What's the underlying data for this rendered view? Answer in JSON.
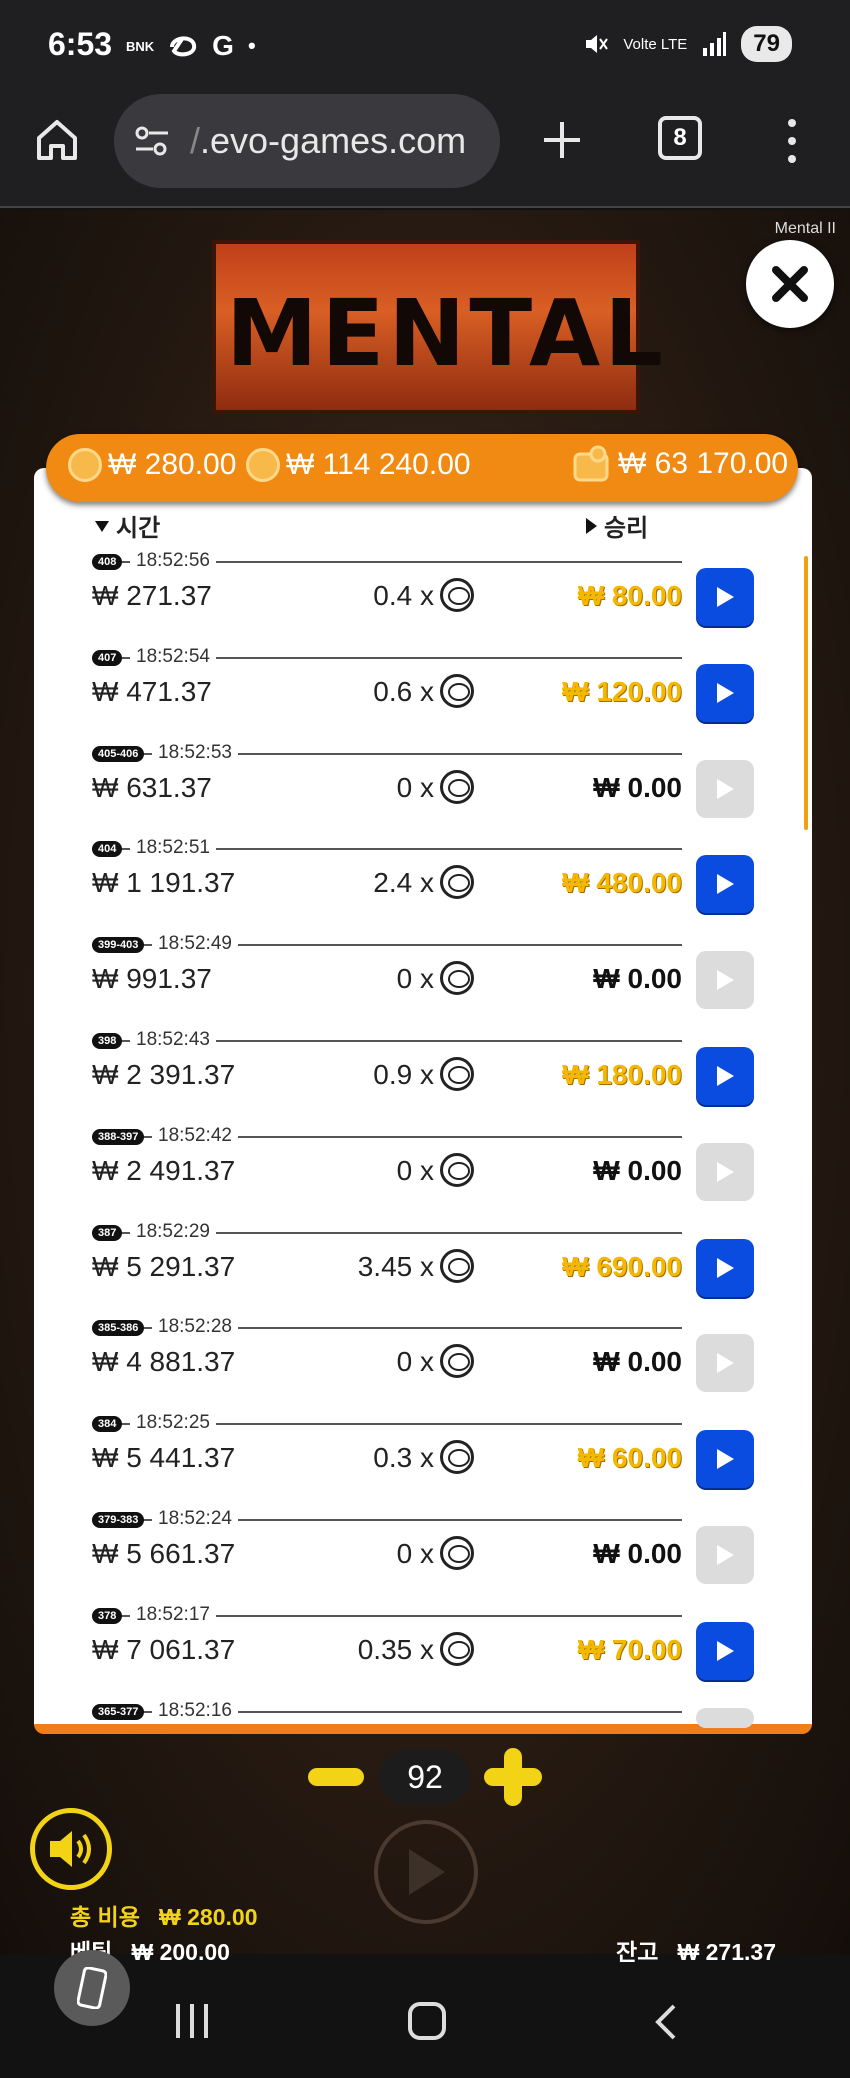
{
  "status_bar": {
    "time": "6:53",
    "left_icons": [
      "BNK",
      "threads-icon",
      "G",
      "•"
    ],
    "network": "Volte LTE",
    "battery": "79"
  },
  "browser": {
    "url_prefix": "/",
    "url": ".evo-games.com",
    "tab_count": "8"
  },
  "game": {
    "title_tag": "Mental II",
    "logo_text": "MENTAL"
  },
  "totals": {
    "cost": "₩ 280.00",
    "total_won": "₩ 114 240.00",
    "wallet": "₩ 63 170.00"
  },
  "columns": {
    "time": "시간",
    "win": "승리"
  },
  "rows": [
    {
      "id": "408",
      "time": "18:52:56",
      "balance": "₩ 271.37",
      "mult": "0.4 x",
      "win": "₩ 80.00",
      "positive": true
    },
    {
      "id": "407",
      "time": "18:52:54",
      "balance": "₩ 471.37",
      "mult": "0.6 x",
      "win": "₩ 120.00",
      "positive": true
    },
    {
      "id": "405-406",
      "time": "18:52:53",
      "balance": "₩ 631.37",
      "mult": "0 x",
      "win": "₩ 0.00",
      "positive": false
    },
    {
      "id": "404",
      "time": "18:52:51",
      "balance": "₩ 1 191.37",
      "mult": "2.4 x",
      "win": "₩ 480.00",
      "positive": true
    },
    {
      "id": "399-403",
      "time": "18:52:49",
      "balance": "₩ 991.37",
      "mult": "0 x",
      "win": "₩ 0.00",
      "positive": false
    },
    {
      "id": "398",
      "time": "18:52:43",
      "balance": "₩ 2 391.37",
      "mult": "0.9 x",
      "win": "₩ 180.00",
      "positive": true
    },
    {
      "id": "388-397",
      "time": "18:52:42",
      "balance": "₩ 2 491.37",
      "mult": "0 x",
      "win": "₩ 0.00",
      "positive": false
    },
    {
      "id": "387",
      "time": "18:52:29",
      "balance": "₩ 5 291.37",
      "mult": "3.45 x",
      "win": "₩ 690.00",
      "positive": true
    },
    {
      "id": "385-386",
      "time": "18:52:28",
      "balance": "₩ 4 881.37",
      "mult": "0 x",
      "win": "₩ 0.00",
      "positive": false
    },
    {
      "id": "384",
      "time": "18:52:25",
      "balance": "₩ 5 441.37",
      "mult": "0.3 x",
      "win": "₩ 60.00",
      "positive": true
    },
    {
      "id": "379-383",
      "time": "18:52:24",
      "balance": "₩ 5 661.37",
      "mult": "0 x",
      "win": "₩ 0.00",
      "positive": false
    },
    {
      "id": "378",
      "time": "18:52:17",
      "balance": "₩ 7 061.37",
      "mult": "0.35 x",
      "win": "₩ 70.00",
      "positive": true
    },
    {
      "id": "365-377",
      "time": "18:52:16",
      "balance": "",
      "mult": "",
      "win": "",
      "positive": false
    }
  ],
  "controls": {
    "bet_count": "92",
    "total_cost_label": "총 비용",
    "total_cost_value": "₩ 280.00",
    "bet_label": "베팅",
    "bet_value": "₩ 200.00",
    "balance_label": "잔고",
    "balance_value": "₩ 271.37"
  },
  "colors": {
    "accent": "#f08a12",
    "play_active": "#0a4be0",
    "win_gold": "#f5b800",
    "control_yellow": "#f2d316"
  }
}
